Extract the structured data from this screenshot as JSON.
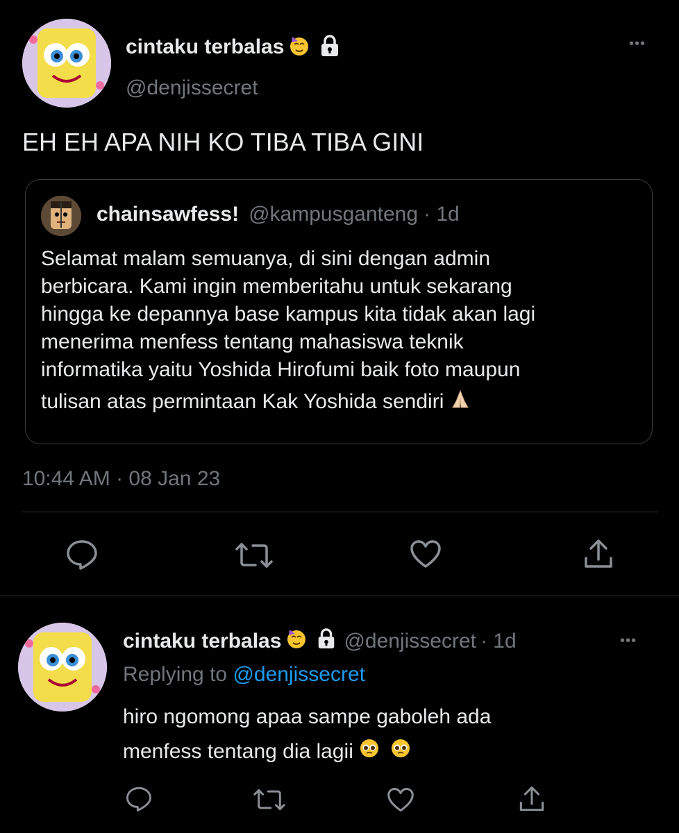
{
  "main_tweet": {
    "display_name": "cintaku terbalas",
    "handle": "@denjissecret",
    "text": "EH EH APA NIH KO TIBA TIBA GINI",
    "timestamp": "10:44 AM · 08 Jan 23",
    "more_label": "•••"
  },
  "quoted_tweet": {
    "display_name": "chainsawfess!",
    "handle": "@kampusganteng",
    "age": "· 1d",
    "lines": [
      "Selamat malam semuanya, di sini dengan admin",
      "berbicara. Kami ingin memberitahu untuk sekarang",
      "hingga ke depannya base kampus kita tidak akan lagi",
      "menerima menfess tentang mahasiswa teknik",
      "informatika yaitu Yoshida Hirofumi baik foto maupun",
      "tulisan atas permintaan Kak Yoshida sendiri"
    ]
  },
  "reply_tweet": {
    "display_name": "cintaku terbalas",
    "handle": "@denjissecret",
    "age": "· 1d",
    "replying_prefix": "Replying to",
    "replying_handle": "@denjissecret",
    "line1": "hiro ngomong apaa sampe gaboleh ada",
    "line2": "menfess tentang dia lagii",
    "more_label": "•••"
  },
  "colors": {
    "background": "#000000",
    "text": "#e7e9ea",
    "muted": "#71767b",
    "accent": "#1d9bf0",
    "divider": "#2f3336"
  }
}
